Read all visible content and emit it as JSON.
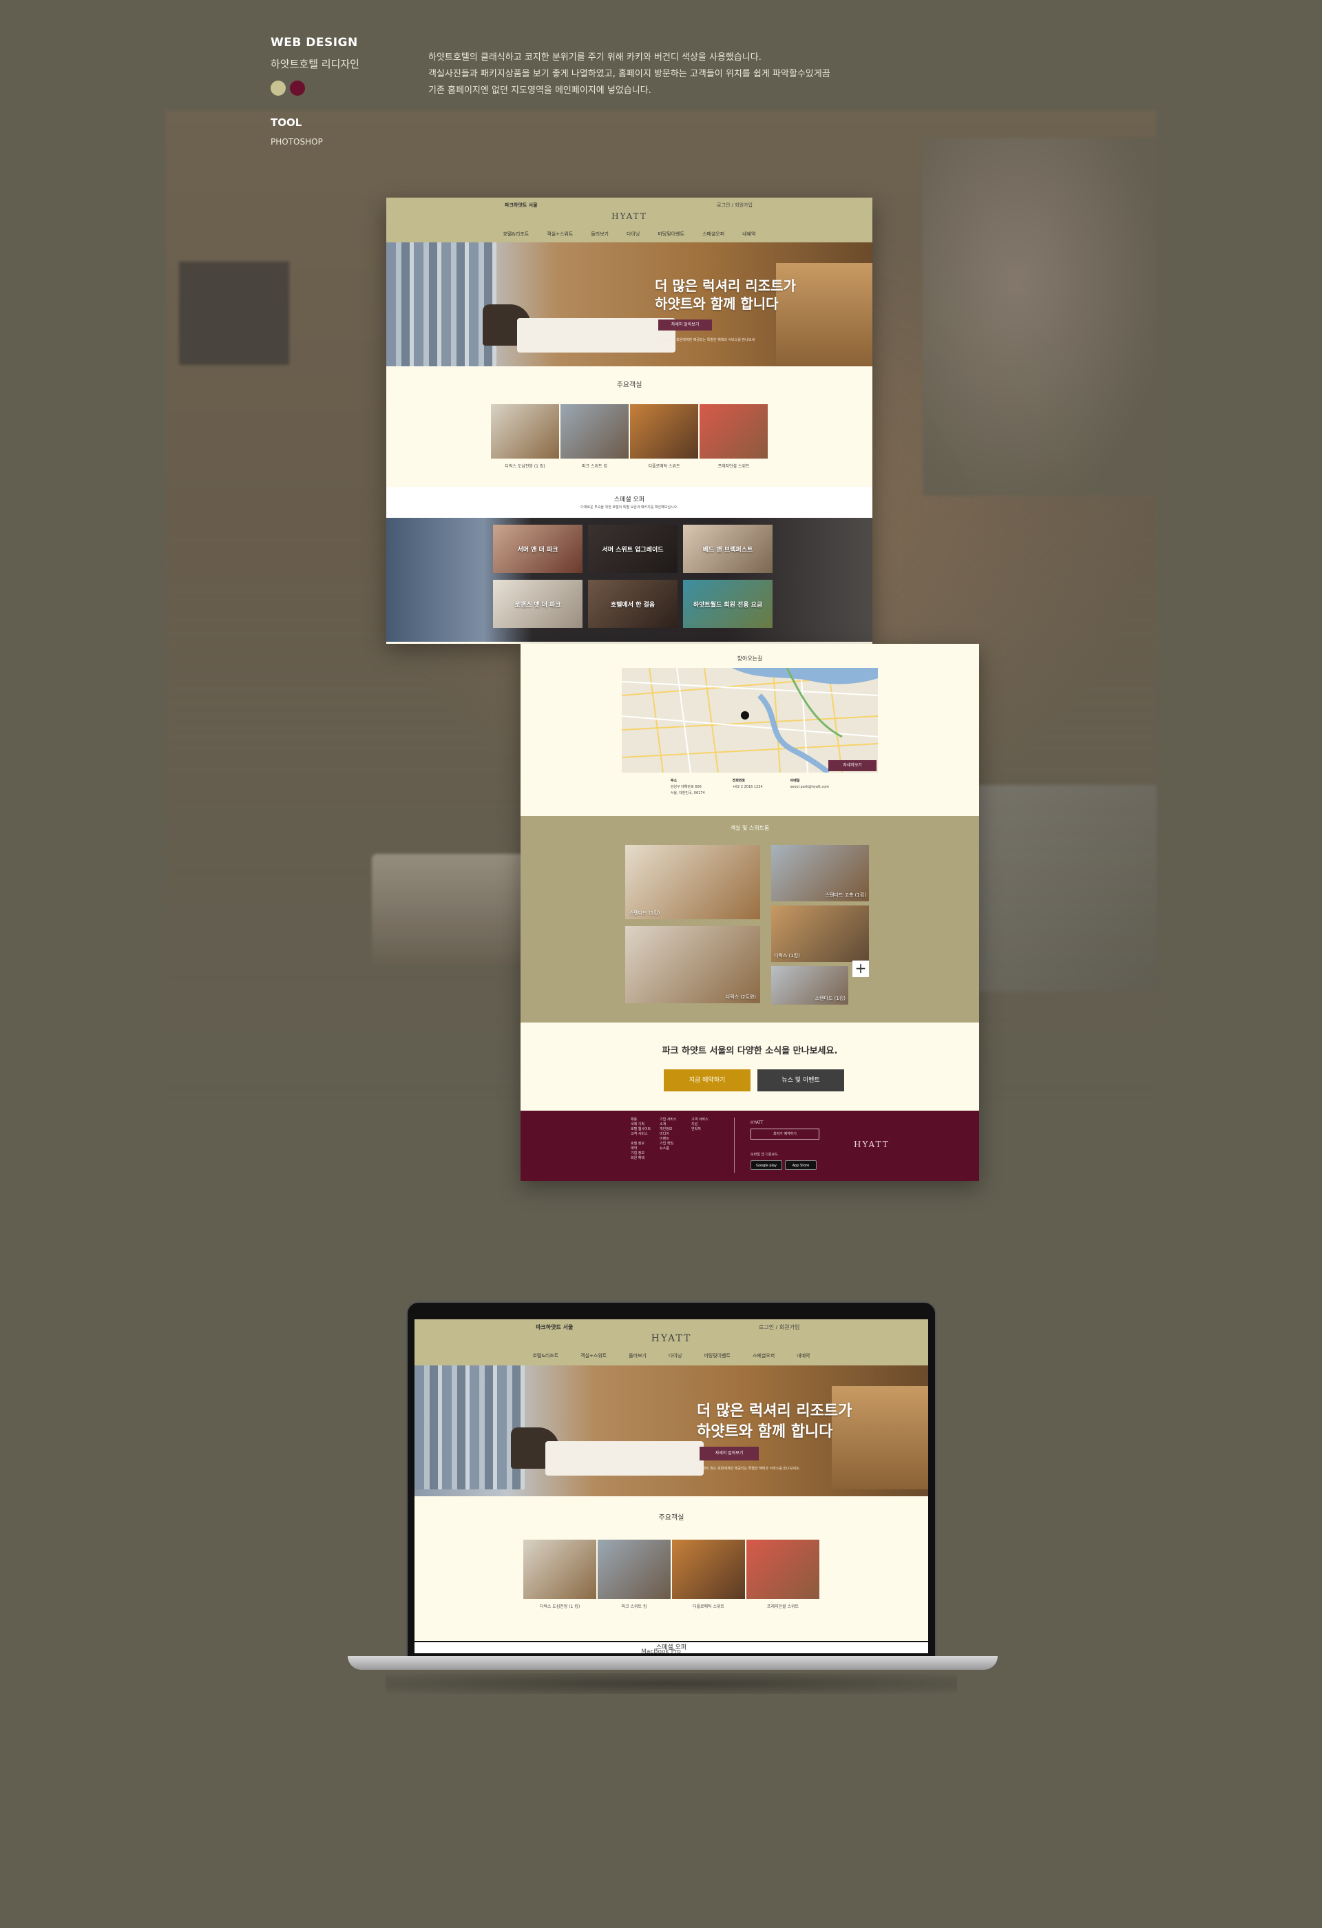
{
  "header": {
    "title": "WEB DESIGN",
    "subtitle": "하얏트호텔 리디자인",
    "colors": [
      "#c9c293",
      "#6a0f2e"
    ],
    "tool_label": "TOOL",
    "tool_value": "PHOTOSHOP",
    "description": [
      "하얏트호텔의 클래식하고 코지한 분위기를 주기 위해 카키와 버건디 색상을 사용했습니다.",
      "객실사진들과 패키지상품을 보기 좋게 나열하였고, 홈페이지  방문하는 고객들이 위치를 쉽게 파악할수있게끔",
      "기존 홈페이지엔 없던 지도영역을 메인페이지에  넣었습니다."
    ]
  },
  "site": {
    "brand": "파크하얏트 서울",
    "login": "로그인 / 회원가입",
    "logo": "HYATT",
    "nav": [
      "호텔&리조트",
      "객실+스위트",
      "둘러보기",
      "다이닝",
      "미팅및이벤트",
      "스페셜오퍼",
      "내예약"
    ],
    "hero_title_line1": "더 많은 럭셔리 리조트가",
    "hero_title_line2": "하얏트와 함께 합니다",
    "hero_button": "자세히 알아보기",
    "hero_text": "하얏트 월드 회원에게만 제공되는 특별한 혜택과 서비스를 만나보세요.",
    "main_rooms_title": "주요객실",
    "main_rooms": [
      "디럭스 도심전망 (1 킹)",
      "파크 스위트 킹",
      "디플로매틱 스위트",
      "프레지던셜 스위트"
    ],
    "offers_title": "스페셜 오퍼",
    "offers_sub": "다채로운 투숙을 위한 호텔의 특별 요금과 패키지를 확인해보십시오.",
    "offers": [
      "서머 앤 더 파크",
      "서머 스위트 업그레이드",
      "베드 앤 브렉퍼스트",
      "로맨스 앳 더 파크",
      "호텔에서 한 걸음",
      "하얏트월드 회원 전용 요금"
    ],
    "map_title": "찾아오는길",
    "map_button": "자세히보기",
    "map_info": [
      {
        "label": "주소",
        "lines": [
          "강남구 테헤란로 606",
          "서울, 대한민국, 06174"
        ]
      },
      {
        "label": "전화번호",
        "lines": [
          "+82 2 2016 1234"
        ]
      },
      {
        "label": "이메일",
        "lines": [
          "seoul.park@hyatt.com"
        ]
      }
    ],
    "suites_title": "객실 및 스위트룸",
    "suites": [
      "스탠다드 (1킹)",
      "스탠다드 고층 (1킹)",
      "디럭스 (1킹)",
      "디럭스 (2트윈)",
      "스탠다드 (1킹)"
    ],
    "news_title": "파크 하얏트 서울의 다양한 소식을 만나보세요.",
    "news_button_primary": "지금 예약하기",
    "news_button_secondary": "뉴스 및 이벤트",
    "footer_cols": [
      [
        "채용",
        "국제 기획",
        "호텔 웹사이트",
        "고객 서비스",
        "",
        "호텔 정보",
        "예약",
        "기업 정보",
        "회원 혜택"
      ],
      [
        "기업 서비스",
        "소개",
        "개인정보",
        "미디어",
        "이벤트",
        "기업 책임",
        "뉴스룸"
      ],
      [
        "고객 서비스",
        "지원",
        "연락처"
      ]
    ],
    "footer_brand": "HYATT",
    "footer_input": "최저가 예약하기",
    "footer_app": "모바일 앱 다운로드",
    "footer_stores": [
      "Google play",
      "App Store"
    ],
    "footer_logo": "HYATT"
  },
  "laptop": {
    "label": "MacBook Pro",
    "offers_title": "스페셜 오퍼"
  }
}
